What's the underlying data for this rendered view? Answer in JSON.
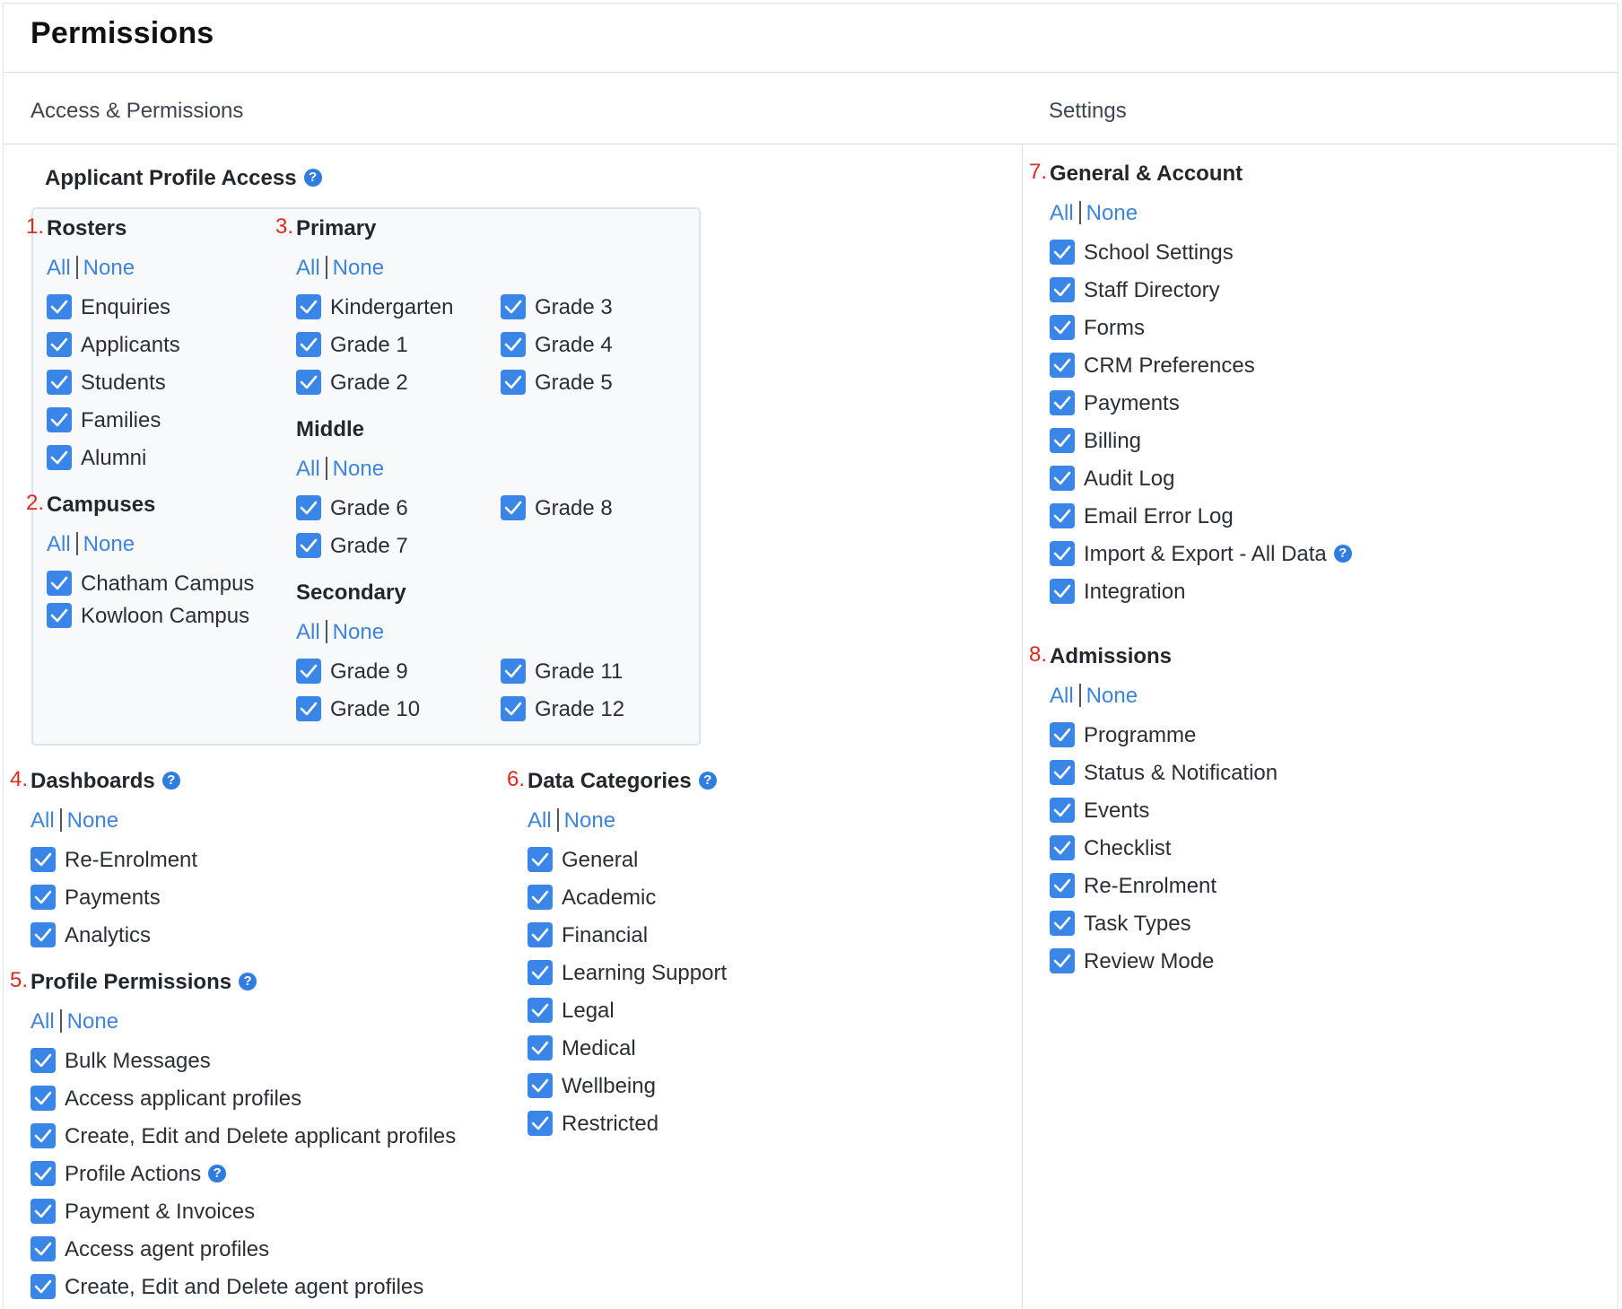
{
  "title": "Permissions",
  "tabs": [
    "Access & Permissions",
    "Settings"
  ],
  "all_label": "All",
  "none_label": "None",
  "profile_access": {
    "heading": "Applicant Profile Access",
    "rosters": {
      "number": "1.",
      "title": "Rosters",
      "items": [
        "Enquiries",
        "Applicants",
        "Students",
        "Families",
        "Alumni"
      ]
    },
    "campuses": {
      "number": "2.",
      "title": "Campuses",
      "items": [
        "Chatham Campus",
        "Kowloon Campus"
      ]
    },
    "primary": {
      "number": "3.",
      "title": "Primary",
      "items": [
        "Kindergarten",
        "Grade 3",
        "Grade 1",
        "Grade 4",
        "Grade 2",
        "Grade 5"
      ]
    },
    "middle": {
      "title": "Middle",
      "items": [
        "Grade 6",
        "Grade 8",
        "Grade 7"
      ]
    },
    "secondary": {
      "title": "Secondary",
      "items": [
        "Grade 9",
        "Grade 11",
        "Grade 10",
        "Grade 12"
      ]
    }
  },
  "dashboards": {
    "number": "4.",
    "title": "Dashboards",
    "items": [
      "Re-Enrolment",
      "Payments",
      "Analytics"
    ]
  },
  "profile_permissions": {
    "number": "5.",
    "title": "Profile Permissions",
    "items": [
      "Bulk Messages",
      "Access applicant profiles",
      "Create, Edit and Delete applicant profiles",
      "Profile Actions",
      "Payment & Invoices",
      "Access agent profiles",
      "Create, Edit and Delete agent profiles"
    ]
  },
  "data_categories": {
    "number": "6.",
    "title": "Data Categories",
    "items": [
      "General",
      "Academic",
      "Financial",
      "Learning Support",
      "Legal",
      "Medical",
      "Wellbeing",
      "Restricted"
    ]
  },
  "general_account": {
    "number": "7.",
    "title": "General & Account",
    "items": [
      "School Settings",
      "Staff Directory",
      "Forms",
      "CRM Preferences",
      "Payments",
      "Billing",
      "Audit Log",
      "Email Error Log",
      "Import & Export - All Data",
      "Integration"
    ]
  },
  "admissions": {
    "number": "8.",
    "title": "Admissions",
    "items": [
      "Programme",
      "Status & Notification",
      "Events",
      "Checklist",
      "Re-Enrolment",
      "Task Types",
      "Review Mode"
    ]
  },
  "colors": {
    "checkbox": "#3a86e8",
    "link": "#3d84e0",
    "number": "#e0281e",
    "border": "#d3e0ea"
  },
  "icons": {
    "checkbox": "checkmark-icon",
    "help": "question-circle-icon"
  }
}
